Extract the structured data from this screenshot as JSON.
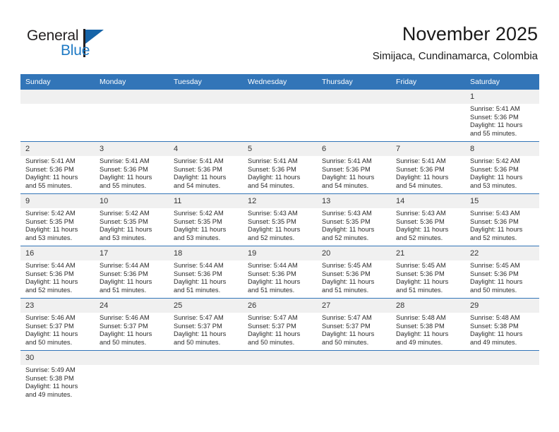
{
  "brand": {
    "name_top": "General",
    "name_bottom": "Blue",
    "accent_color": "#1664a8",
    "text_color": "#231f20"
  },
  "header": {
    "title": "November 2025",
    "subtitle": "Simijaca, Cundinamarca, Colombia"
  },
  "calendar": {
    "header_bg": "#3275b8",
    "header_text_color": "#ffffff",
    "daynum_bg": "#f0f0f0",
    "weekday_headers": [
      "Sunday",
      "Monday",
      "Tuesday",
      "Wednesday",
      "Thursday",
      "Friday",
      "Saturday"
    ],
    "labels": {
      "sunrise": "Sunrise:",
      "sunset": "Sunset:",
      "daylight": "Daylight:"
    },
    "weeks": [
      [
        {
          "day": "",
          "empty": true
        },
        {
          "day": "",
          "empty": true
        },
        {
          "day": "",
          "empty": true
        },
        {
          "day": "",
          "empty": true
        },
        {
          "day": "",
          "empty": true
        },
        {
          "day": "",
          "empty": true
        },
        {
          "day": "1",
          "sunrise": "Sunrise: 5:41 AM",
          "sunset": "Sunset: 5:36 PM",
          "daylight_l1": "Daylight: 11 hours",
          "daylight_l2": "and 55 minutes."
        }
      ],
      [
        {
          "day": "2",
          "sunrise": "Sunrise: 5:41 AM",
          "sunset": "Sunset: 5:36 PM",
          "daylight_l1": "Daylight: 11 hours",
          "daylight_l2": "and 55 minutes."
        },
        {
          "day": "3",
          "sunrise": "Sunrise: 5:41 AM",
          "sunset": "Sunset: 5:36 PM",
          "daylight_l1": "Daylight: 11 hours",
          "daylight_l2": "and 55 minutes."
        },
        {
          "day": "4",
          "sunrise": "Sunrise: 5:41 AM",
          "sunset": "Sunset: 5:36 PM",
          "daylight_l1": "Daylight: 11 hours",
          "daylight_l2": "and 54 minutes."
        },
        {
          "day": "5",
          "sunrise": "Sunrise: 5:41 AM",
          "sunset": "Sunset: 5:36 PM",
          "daylight_l1": "Daylight: 11 hours",
          "daylight_l2": "and 54 minutes."
        },
        {
          "day": "6",
          "sunrise": "Sunrise: 5:41 AM",
          "sunset": "Sunset: 5:36 PM",
          "daylight_l1": "Daylight: 11 hours",
          "daylight_l2": "and 54 minutes."
        },
        {
          "day": "7",
          "sunrise": "Sunrise: 5:41 AM",
          "sunset": "Sunset: 5:36 PM",
          "daylight_l1": "Daylight: 11 hours",
          "daylight_l2": "and 54 minutes."
        },
        {
          "day": "8",
          "sunrise": "Sunrise: 5:42 AM",
          "sunset": "Sunset: 5:36 PM",
          "daylight_l1": "Daylight: 11 hours",
          "daylight_l2": "and 53 minutes."
        }
      ],
      [
        {
          "day": "9",
          "sunrise": "Sunrise: 5:42 AM",
          "sunset": "Sunset: 5:35 PM",
          "daylight_l1": "Daylight: 11 hours",
          "daylight_l2": "and 53 minutes."
        },
        {
          "day": "10",
          "sunrise": "Sunrise: 5:42 AM",
          "sunset": "Sunset: 5:35 PM",
          "daylight_l1": "Daylight: 11 hours",
          "daylight_l2": "and 53 minutes."
        },
        {
          "day": "11",
          "sunrise": "Sunrise: 5:42 AM",
          "sunset": "Sunset: 5:35 PM",
          "daylight_l1": "Daylight: 11 hours",
          "daylight_l2": "and 53 minutes."
        },
        {
          "day": "12",
          "sunrise": "Sunrise: 5:43 AM",
          "sunset": "Sunset: 5:35 PM",
          "daylight_l1": "Daylight: 11 hours",
          "daylight_l2": "and 52 minutes."
        },
        {
          "day": "13",
          "sunrise": "Sunrise: 5:43 AM",
          "sunset": "Sunset: 5:35 PM",
          "daylight_l1": "Daylight: 11 hours",
          "daylight_l2": "and 52 minutes."
        },
        {
          "day": "14",
          "sunrise": "Sunrise: 5:43 AM",
          "sunset": "Sunset: 5:36 PM",
          "daylight_l1": "Daylight: 11 hours",
          "daylight_l2": "and 52 minutes."
        },
        {
          "day": "15",
          "sunrise": "Sunrise: 5:43 AM",
          "sunset": "Sunset: 5:36 PM",
          "daylight_l1": "Daylight: 11 hours",
          "daylight_l2": "and 52 minutes."
        }
      ],
      [
        {
          "day": "16",
          "sunrise": "Sunrise: 5:44 AM",
          "sunset": "Sunset: 5:36 PM",
          "daylight_l1": "Daylight: 11 hours",
          "daylight_l2": "and 52 minutes."
        },
        {
          "day": "17",
          "sunrise": "Sunrise: 5:44 AM",
          "sunset": "Sunset: 5:36 PM",
          "daylight_l1": "Daylight: 11 hours",
          "daylight_l2": "and 51 minutes."
        },
        {
          "day": "18",
          "sunrise": "Sunrise: 5:44 AM",
          "sunset": "Sunset: 5:36 PM",
          "daylight_l1": "Daylight: 11 hours",
          "daylight_l2": "and 51 minutes."
        },
        {
          "day": "19",
          "sunrise": "Sunrise: 5:44 AM",
          "sunset": "Sunset: 5:36 PM",
          "daylight_l1": "Daylight: 11 hours",
          "daylight_l2": "and 51 minutes."
        },
        {
          "day": "20",
          "sunrise": "Sunrise: 5:45 AM",
          "sunset": "Sunset: 5:36 PM",
          "daylight_l1": "Daylight: 11 hours",
          "daylight_l2": "and 51 minutes."
        },
        {
          "day": "21",
          "sunrise": "Sunrise: 5:45 AM",
          "sunset": "Sunset: 5:36 PM",
          "daylight_l1": "Daylight: 11 hours",
          "daylight_l2": "and 51 minutes."
        },
        {
          "day": "22",
          "sunrise": "Sunrise: 5:45 AM",
          "sunset": "Sunset: 5:36 PM",
          "daylight_l1": "Daylight: 11 hours",
          "daylight_l2": "and 50 minutes."
        }
      ],
      [
        {
          "day": "23",
          "sunrise": "Sunrise: 5:46 AM",
          "sunset": "Sunset: 5:37 PM",
          "daylight_l1": "Daylight: 11 hours",
          "daylight_l2": "and 50 minutes."
        },
        {
          "day": "24",
          "sunrise": "Sunrise: 5:46 AM",
          "sunset": "Sunset: 5:37 PM",
          "daylight_l1": "Daylight: 11 hours",
          "daylight_l2": "and 50 minutes."
        },
        {
          "day": "25",
          "sunrise": "Sunrise: 5:47 AM",
          "sunset": "Sunset: 5:37 PM",
          "daylight_l1": "Daylight: 11 hours",
          "daylight_l2": "and 50 minutes."
        },
        {
          "day": "26",
          "sunrise": "Sunrise: 5:47 AM",
          "sunset": "Sunset: 5:37 PM",
          "daylight_l1": "Daylight: 11 hours",
          "daylight_l2": "and 50 minutes."
        },
        {
          "day": "27",
          "sunrise": "Sunrise: 5:47 AM",
          "sunset": "Sunset: 5:37 PM",
          "daylight_l1": "Daylight: 11 hours",
          "daylight_l2": "and 50 minutes."
        },
        {
          "day": "28",
          "sunrise": "Sunrise: 5:48 AM",
          "sunset": "Sunset: 5:38 PM",
          "daylight_l1": "Daylight: 11 hours",
          "daylight_l2": "and 49 minutes."
        },
        {
          "day": "29",
          "sunrise": "Sunrise: 5:48 AM",
          "sunset": "Sunset: 5:38 PM",
          "daylight_l1": "Daylight: 11 hours",
          "daylight_l2": "and 49 minutes."
        }
      ],
      [
        {
          "day": "30",
          "sunrise": "Sunrise: 5:49 AM",
          "sunset": "Sunset: 5:38 PM",
          "daylight_l1": "Daylight: 11 hours",
          "daylight_l2": "and 49 minutes."
        },
        {
          "day": "",
          "empty": true
        },
        {
          "day": "",
          "empty": true
        },
        {
          "day": "",
          "empty": true
        },
        {
          "day": "",
          "empty": true
        },
        {
          "day": "",
          "empty": true
        },
        {
          "day": "",
          "empty": true
        }
      ]
    ]
  }
}
